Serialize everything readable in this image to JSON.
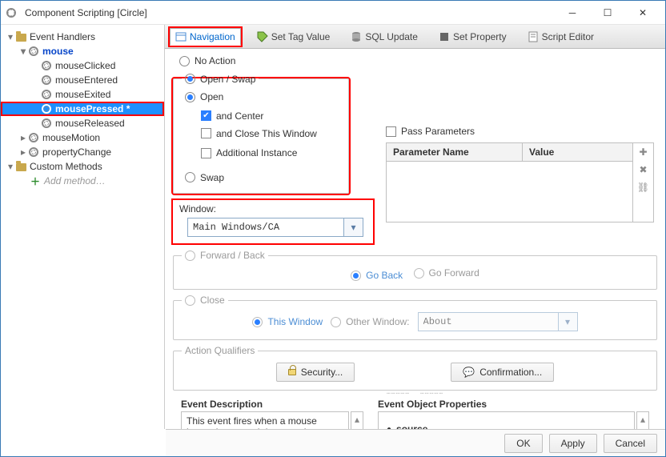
{
  "window": {
    "title": "Component Scripting [Circle]"
  },
  "sidebar": {
    "root1": "Event Handlers",
    "mouse": "mouse",
    "events": [
      "mouseClicked",
      "mouseEntered",
      "mouseExited",
      "mousePressed *",
      "mouseReleased"
    ],
    "mouseMotion": "mouseMotion",
    "propertyChange": "propertyChange",
    "root2": "Custom Methods",
    "addMethod": "Add method…"
  },
  "tabs": {
    "navigation": "Navigation",
    "setTag": "Set Tag Value",
    "sql": "SQL Update",
    "setProp": "Set Property",
    "script": "Script Editor"
  },
  "panel": {
    "noAction": "No Action",
    "openSwap": "Open / Swap",
    "open": "Open",
    "andCenter": "and Center",
    "andClose": "and Close This Window",
    "additional": "Additional Instance",
    "swap": "Swap",
    "windowLabel": "Window:",
    "windowValue": "Main Windows/CA",
    "passParams": "Pass Parameters",
    "paramName": "Parameter Name",
    "paramValue": "Value",
    "fwdBack": "Forward / Back",
    "goBack": "Go Back",
    "goForward": "Go Forward",
    "close": "Close",
    "thisWindow": "This Window",
    "otherWindow": "Other Window:",
    "otherWindowValue": "About",
    "actionQualifiers": "Action Qualifiers",
    "security": "Security...",
    "confirmation": "Confirmation..."
  },
  "lower": {
    "descLabel": "Event Description",
    "descText": "This event fires when a mouse button is pressed down on the",
    "propsLabel": "Event Object Properties",
    "source": "source"
  },
  "footer": {
    "ok": "OK",
    "apply": "Apply",
    "cancel": "Cancel"
  }
}
